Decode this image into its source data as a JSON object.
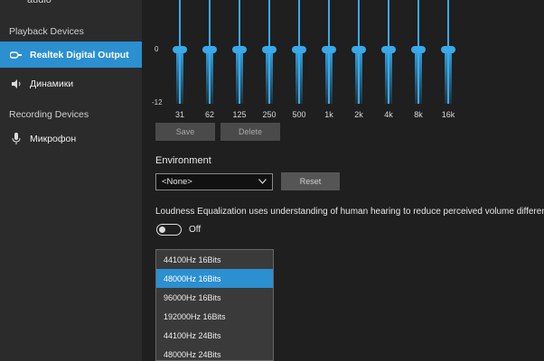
{
  "sidebar": {
    "top_fragment": "audio",
    "playback_title": "Playback Devices",
    "recording_title": "Recording Devices",
    "items": [
      {
        "label": "Realtek Digital Output",
        "icon": "digital-output-icon",
        "active": true
      },
      {
        "label": "Динамики",
        "icon": "speaker-icon",
        "active": false
      },
      {
        "label": "Микрофон",
        "icon": "microphone-icon",
        "active": false
      }
    ]
  },
  "equalizer": {
    "scale_mid": "0",
    "scale_low": "-12",
    "bands": [
      {
        "freq": "31",
        "gain_db": 0
      },
      {
        "freq": "62",
        "gain_db": 0
      },
      {
        "freq": "125",
        "gain_db": 0
      },
      {
        "freq": "250",
        "gain_db": 0
      },
      {
        "freq": "500",
        "gain_db": 0
      },
      {
        "freq": "1k",
        "gain_db": 0
      },
      {
        "freq": "2k",
        "gain_db": 0
      },
      {
        "freq": "4k",
        "gain_db": 0
      },
      {
        "freq": "8k",
        "gain_db": 0
      },
      {
        "freq": "16k",
        "gain_db": 0
      }
    ],
    "save_label": "Save",
    "delete_label": "Delete"
  },
  "environment": {
    "title": "Environment",
    "selected": "<None>",
    "reset_label": "Reset"
  },
  "loudness": {
    "description": "Loudness Equalization uses understanding of human hearing to reduce perceived volume differences",
    "toggle_state": "Off"
  },
  "format_dropdown": {
    "options": [
      "44100Hz 16Bits",
      "48000Hz 16Bits",
      "96000Hz 16Bits",
      "192000Hz 16Bits",
      "44100Hz 24Bits",
      "48000Hz 24Bits"
    ],
    "selected_index": 1
  },
  "colors": {
    "accent": "#2b8fd0",
    "slider": "#3aa9ea"
  }
}
